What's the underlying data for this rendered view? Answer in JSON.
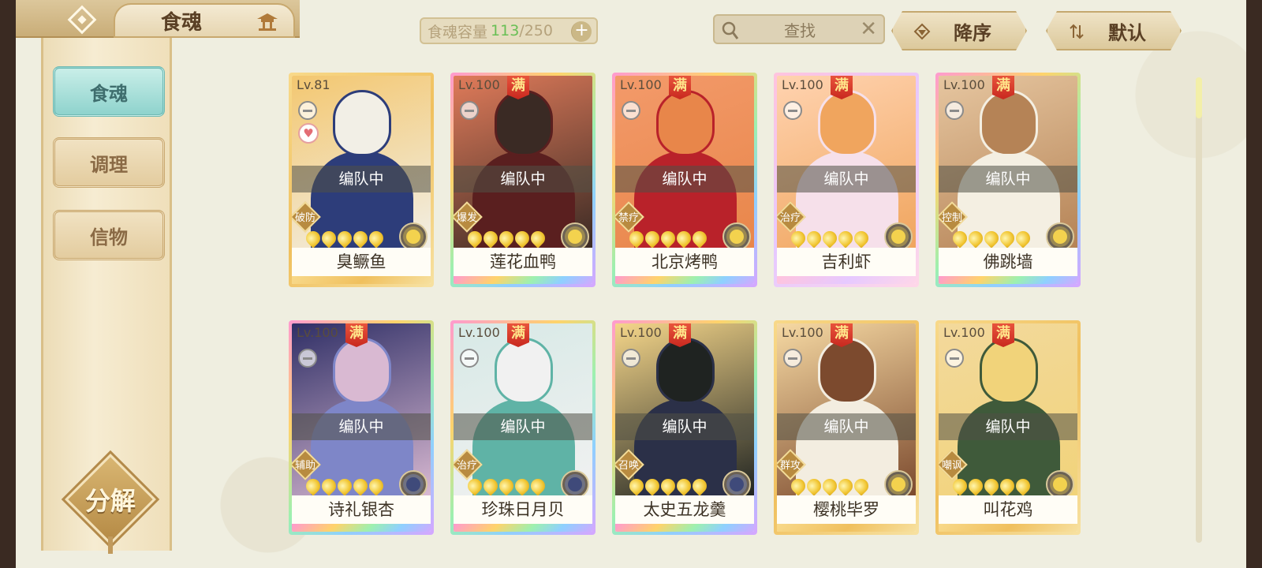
{
  "header": {
    "title": "食魂",
    "capacity": {
      "label": "食魂容量",
      "current": "113",
      "separator": "/",
      "max": "250",
      "add": "+"
    },
    "search": {
      "placeholder": "查找",
      "clear": "✕"
    },
    "sort_order": "降序",
    "sort_mode": "默认"
  },
  "sidebar": {
    "items": [
      {
        "label": "食魂",
        "active": true
      },
      {
        "label": "调理",
        "active": false
      },
      {
        "label": "信物",
        "active": false
      }
    ],
    "decompose": "分解"
  },
  "cards": [
    {
      "level": "Lv.81",
      "max": "",
      "team": "编队中",
      "role": "破防",
      "name": "臭鳜鱼",
      "frame": "gold",
      "heart": "♥",
      "rarity": "gold",
      "art": [
        "#f3c770",
        "#2d3d7a",
        "#f2efe6"
      ]
    },
    {
      "level": "Lv.100",
      "max": "满",
      "team": "编队中",
      "role": "爆发",
      "name": "莲花血鸭",
      "frame": "rainbow",
      "heart": "",
      "rarity": "gold",
      "art": [
        "#e07b5a",
        "#5a1f1f",
        "#3a2a24"
      ]
    },
    {
      "level": "Lv.100",
      "max": "满",
      "team": "编队中",
      "role": "禁疗",
      "name": "北京烤鸭",
      "frame": "rainbow",
      "heart": "",
      "rarity": "gold",
      "art": [
        "#f39a6a",
        "#b9222a",
        "#e8864a"
      ]
    },
    {
      "level": "Lv.100",
      "max": "满",
      "team": "编队中",
      "role": "治疗",
      "name": "吉利虾",
      "frame": "pink",
      "heart": "",
      "rarity": "gold",
      "art": [
        "#ffd3b0",
        "#f6e0ea",
        "#f0a55e"
      ]
    },
    {
      "level": "Lv.100",
      "max": "满",
      "team": "编队中",
      "role": "控制",
      "name": "佛跳墙",
      "frame": "rainbow",
      "heart": "",
      "rarity": "gold",
      "art": [
        "#e6c6a0",
        "#f4efe2",
        "#b58356"
      ]
    },
    {
      "level": "Lv.100",
      "max": "满",
      "team": "编队中",
      "role": "辅助",
      "name": "诗礼银杏",
      "frame": "rainbow",
      "heart": "",
      "rarity": "dark",
      "art": [
        "#2f2f66",
        "#7e86c8",
        "#d9b9d2"
      ]
    },
    {
      "level": "Lv.100",
      "max": "满",
      "team": "编队中",
      "role": "治疗",
      "name": "珍珠日月贝",
      "frame": "rainbow",
      "heart": "",
      "rarity": "dark",
      "art": [
        "#d7e9e6",
        "#5fb3a6",
        "#f1f1f1"
      ]
    },
    {
      "level": "Lv.100",
      "max": "满",
      "team": "编队中",
      "role": "召唤",
      "name": "太史五龙羹",
      "frame": "rainbow",
      "heart": "",
      "rarity": "dark",
      "art": [
        "#f5d68a",
        "#2b3048",
        "#1f2321"
      ]
    },
    {
      "level": "Lv.100",
      "max": "满",
      "team": "编队中",
      "role": "群攻",
      "name": "樱桃毕罗",
      "frame": "gold",
      "heart": "",
      "rarity": "gold",
      "art": [
        "#f6d9a3",
        "#f3ede0",
        "#7c4a2e"
      ]
    },
    {
      "level": "Lv.100",
      "max": "满",
      "team": "编队中",
      "role": "嘲讽",
      "name": "叫花鸡",
      "frame": "gold",
      "heart": "",
      "rarity": "gold",
      "art": [
        "#f3d99c",
        "#3f5a3a",
        "#f1d37a"
      ]
    }
  ]
}
